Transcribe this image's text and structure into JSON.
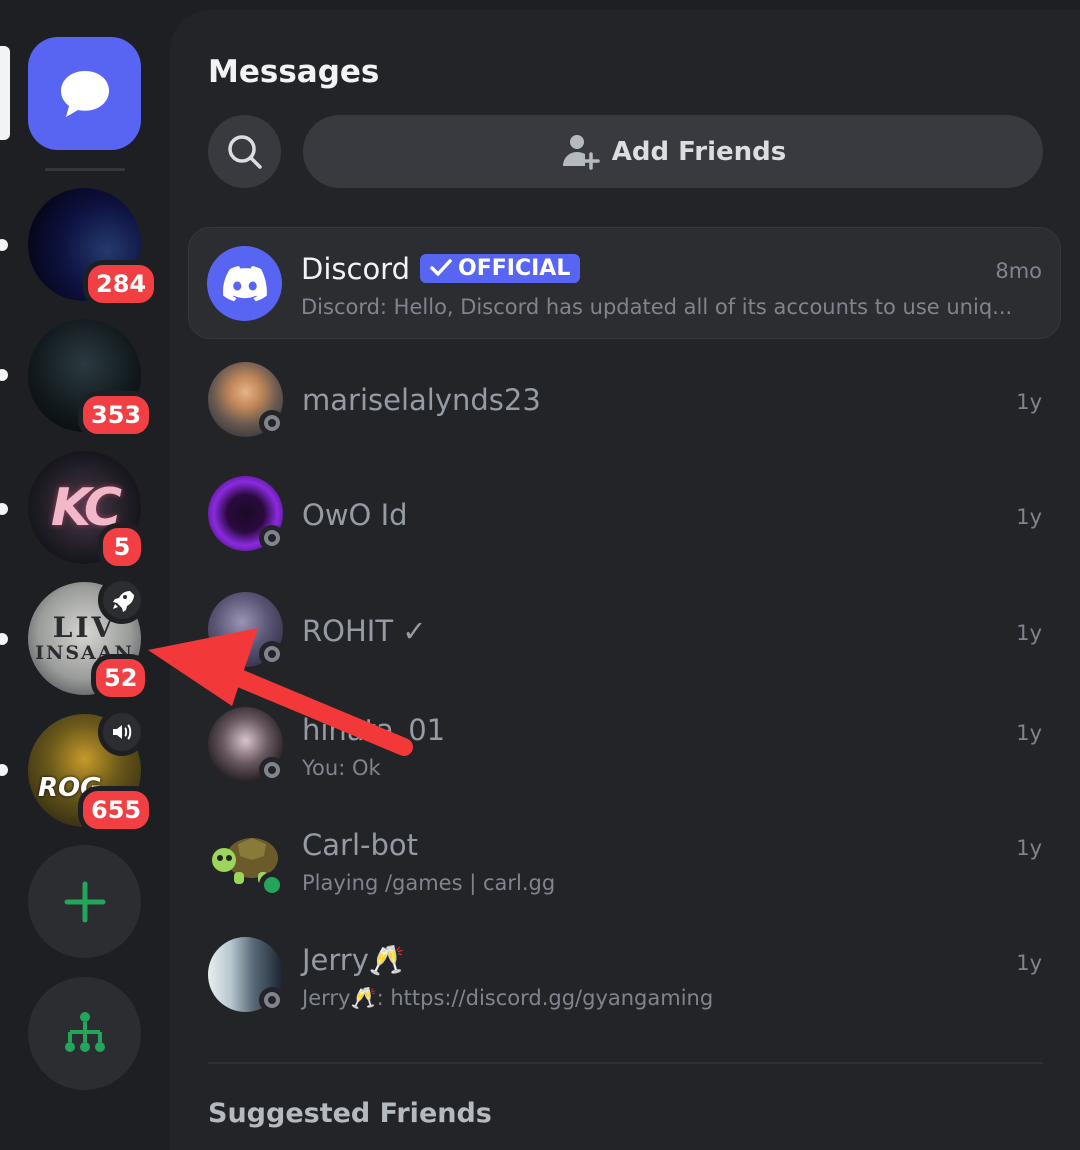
{
  "rail": {
    "servers": [
      {
        "name": "server-1",
        "badge": "284"
      },
      {
        "name": "server-2",
        "badge": "353"
      },
      {
        "name": "server-kc",
        "badge": "5",
        "art_text": "KC"
      },
      {
        "name": "server-livinsaan",
        "badge": "52",
        "art_text_1": "LIV",
        "art_text_2": "INSAAN",
        "corner_icon": "rocket-icon"
      },
      {
        "name": "server-rog",
        "badge": "655",
        "art_text": "ROG",
        "corner_icon": "speaker-icon"
      }
    ],
    "add_server_icon": "plus-icon",
    "discover_icon": "hub-tree-icon"
  },
  "header": {
    "title": "Messages",
    "add_friends_label": "Add Friends"
  },
  "dms": [
    {
      "name": "Discord",
      "badge": "OFFICIAL",
      "preview": "Discord: Hello, Discord has updated all of its accounts to use uniq...",
      "time": "8mo",
      "status": "none"
    },
    {
      "name": "mariselalynds23",
      "preview": "",
      "time": "1y",
      "status": "offline"
    },
    {
      "name": "OwO Id",
      "preview": "",
      "time": "1y",
      "status": "offline"
    },
    {
      "name": "ROHIT ✓",
      "preview": "",
      "time": "1y",
      "status": "offline"
    },
    {
      "name": "hinata_01",
      "preview": "You: Ok",
      "time": "1y",
      "status": "offline"
    },
    {
      "name": "Carl-bot",
      "preview": "Playing /games | carl.gg",
      "time": "1y",
      "status": "online"
    },
    {
      "name": "Jerry🥂",
      "preview": "Jerry🥂: https://discord.gg/gyangaming",
      "time": "1y",
      "status": "offline"
    }
  ],
  "suggested_title": "Suggested Friends",
  "colors": {
    "accent": "#5865f2",
    "badge_red": "#f23f43",
    "online_green": "#23a55a",
    "annotation_arrow": "#f23838"
  }
}
